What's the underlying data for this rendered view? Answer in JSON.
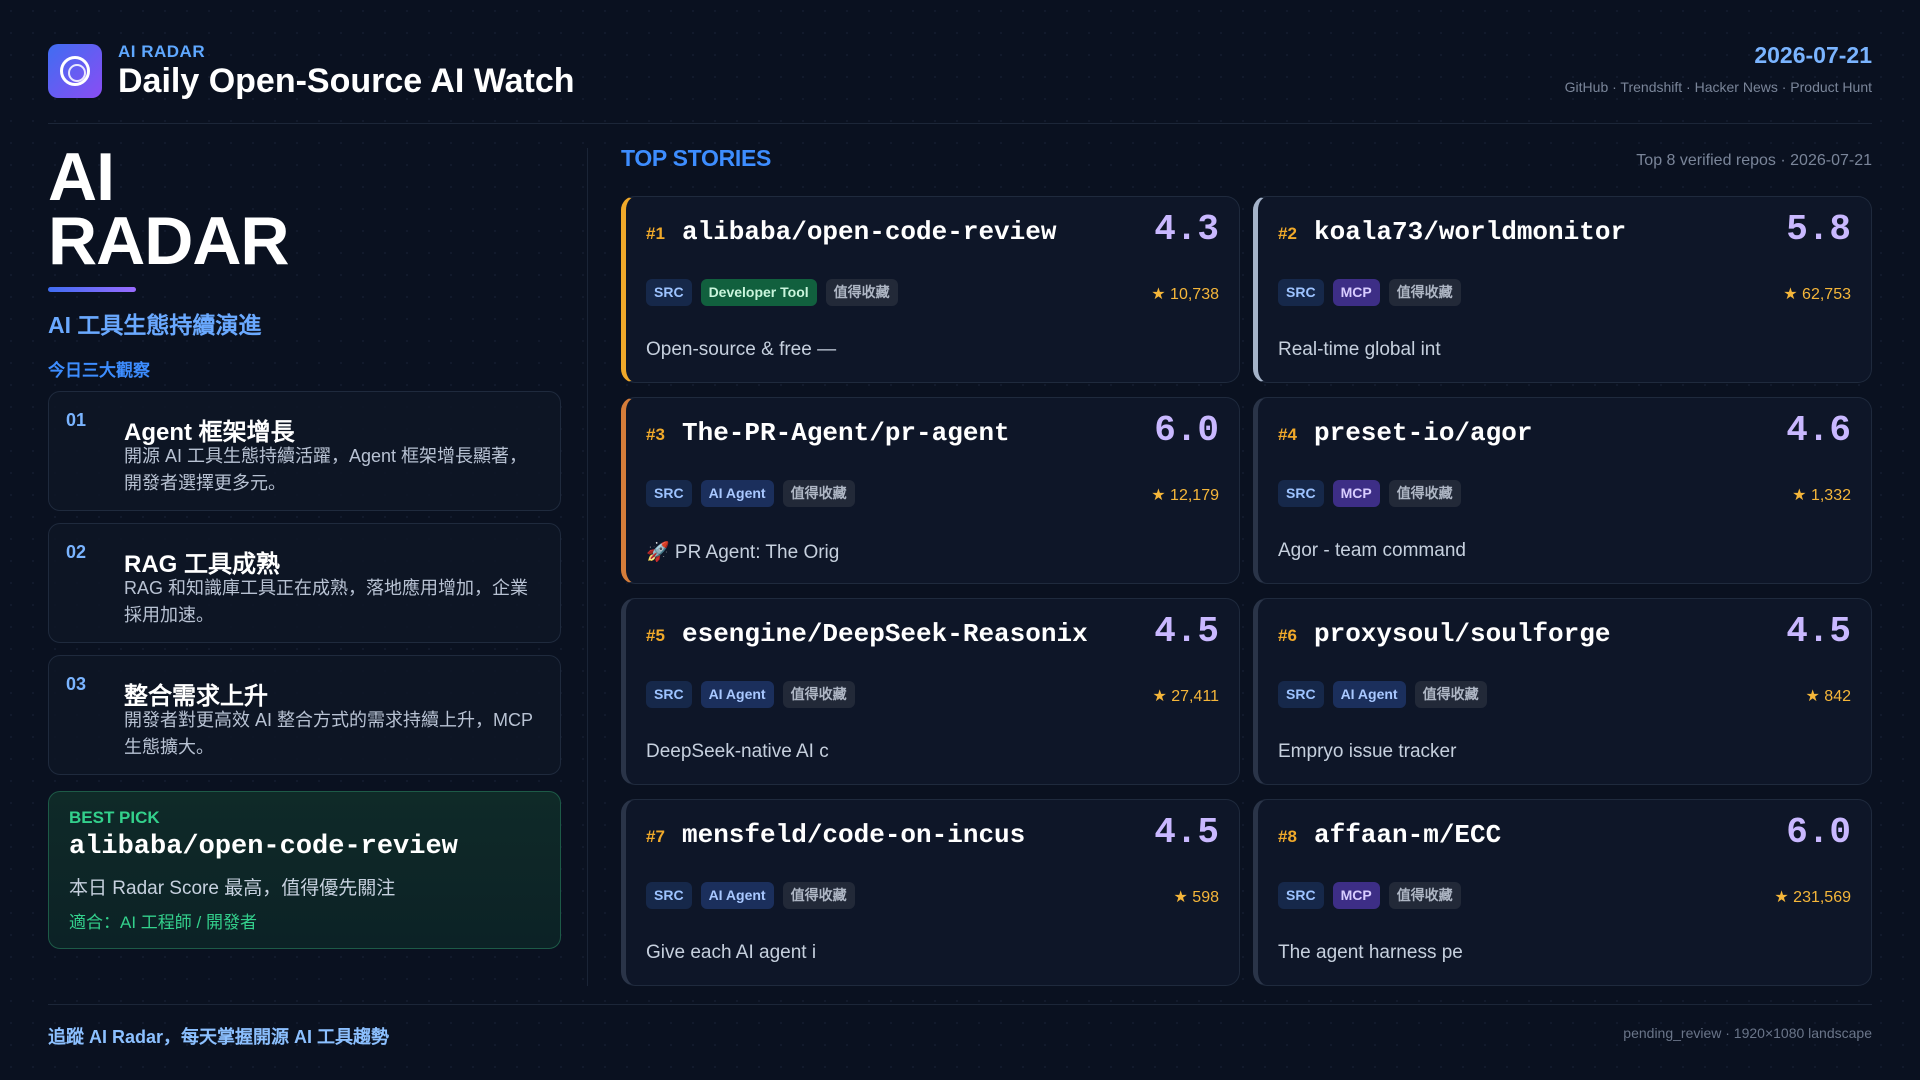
{
  "header": {
    "kicker": "AI RADAR",
    "title": "Daily Open-Source AI Watch",
    "date": "2026-07-21",
    "sources": "GitHub · Trendshift · Hacker News · Product Hunt",
    "logo_icon": "radar-ring-icon"
  },
  "left": {
    "hero_line1": "AI",
    "hero_line2": "RADAR",
    "subtitle": "AI 工具生態持續演進",
    "insights_label": "今日三大觀察",
    "insights": [
      {
        "num": "01",
        "title": "Agent 框架增長",
        "body": "開源 AI 工具生態持續活躍，Agent 框架增長顯著，開發者選擇更多元。"
      },
      {
        "num": "02",
        "title": "RAG 工具成熟",
        "body": "RAG 和知識庫工具正在成熟，落地應用增加，企業採用加速。"
      },
      {
        "num": "03",
        "title": "整合需求上升",
        "body": "開發者對更高效 AI 整合方式的需求持續上升，MCP 生態擴大。"
      }
    ],
    "best_pick": {
      "label": "BEST PICK",
      "repo": "alibaba/open-code-review",
      "desc": "本日 Radar Score 最高，值得優先關注",
      "fit": "適合：AI 工程師 / 開發者"
    }
  },
  "top_stories": {
    "label": "TOP STORIES",
    "meta": "Top 8 verified repos · 2026-07-21",
    "cards": [
      {
        "rank": "#1",
        "repo": "alibaba/open-code-review",
        "score": "4.3",
        "tags": [
          "SRC",
          "Developer Tool",
          "值得收藏"
        ],
        "stars": "★ 10,738",
        "desc": "Open-source & free —"
      },
      {
        "rank": "#2",
        "repo": "koala73/worldmonitor",
        "score": "5.8",
        "tags": [
          "SRC",
          "MCP",
          "值得收藏"
        ],
        "stars": "★ 62,753",
        "desc": "Real-time global int"
      },
      {
        "rank": "#3",
        "repo": "The-PR-Agent/pr-agent",
        "score": "6.0",
        "tags": [
          "SRC",
          "AI Agent",
          "值得收藏"
        ],
        "stars": "★ 12,179",
        "desc": "🚀 PR Agent: The Orig"
      },
      {
        "rank": "#4",
        "repo": "preset-io/agor",
        "score": "4.6",
        "tags": [
          "SRC",
          "MCP",
          "值得收藏"
        ],
        "stars": "★ 1,332",
        "desc": "Agor - team command"
      },
      {
        "rank": "#5",
        "repo": "esengine/DeepSeek-Reasonix",
        "score": "4.5",
        "tags": [
          "SRC",
          "AI Agent",
          "值得收藏"
        ],
        "stars": "★ 27,411",
        "desc": "DeepSeek-native AI c"
      },
      {
        "rank": "#6",
        "repo": "proxysoul/soulforge",
        "score": "4.5",
        "tags": [
          "SRC",
          "AI Agent",
          "值得收藏"
        ],
        "stars": "★ 842",
        "desc": "Empryo issue tracker"
      },
      {
        "rank": "#7",
        "repo": "mensfeld/code-on-incus",
        "score": "4.5",
        "tags": [
          "SRC",
          "AI Agent",
          "值得收藏"
        ],
        "stars": "★ 598",
        "desc": "Give each AI agent i"
      },
      {
        "rank": "#8",
        "repo": "affaan-m/ECC",
        "score": "6.0",
        "tags": [
          "SRC",
          "MCP",
          "值得收藏"
        ],
        "stars": "★ 231,569",
        "desc": "The agent harness pe"
      }
    ]
  },
  "footer": {
    "left": "追蹤 AI Radar，每天掌握開源 AI 工具趨勢",
    "right": "pending_review · 1920×1080 landscape"
  },
  "colors": {
    "background": "#0a1120",
    "accent_blue": "#3d8dff",
    "score": "#c9b8ff",
    "rank": "#f0a92a",
    "star": "#f5b63a",
    "best_pick_green": "#33d08c",
    "tag_src": "#16284a",
    "tag_dev": "#11603e",
    "tag_agent": "#1b2f5c",
    "tag_mcp": "#3d2e86",
    "tag_save": "#222938"
  }
}
